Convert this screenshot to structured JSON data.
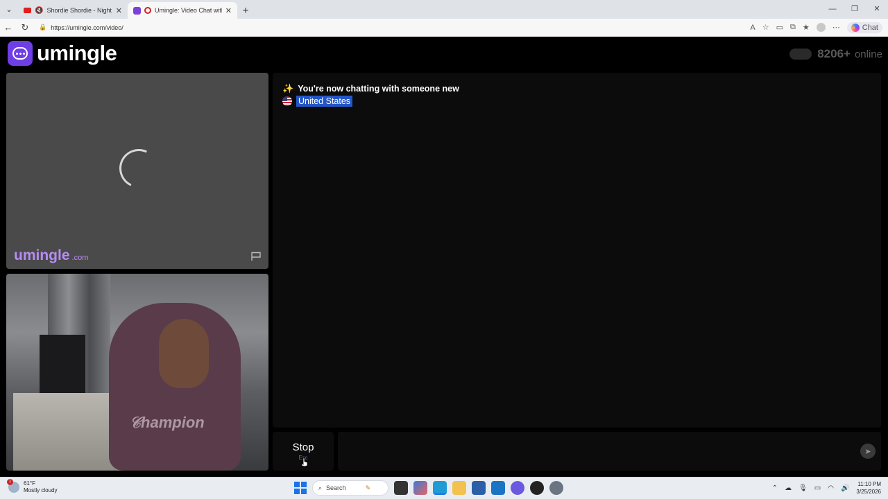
{
  "browser": {
    "tabs": [
      {
        "title": "Shordie Shordie - Night Time",
        "icon": "youtube-icon",
        "muted": true
      },
      {
        "title": "Umingle: Video Chat with Str",
        "icon": "umingle-icon",
        "recording": true
      }
    ],
    "url": "https://umingle.com/video/",
    "chat_label": "Chat"
  },
  "site": {
    "logo_text": "umingle",
    "online_count": "8206+",
    "online_label": "online",
    "watermark_main": "umingle",
    "watermark_tld": ".com",
    "chat": {
      "status_message": "You're now chatting with someone new",
      "country": "United States"
    },
    "stop_label": "Stop",
    "stop_shortcut": "Esc",
    "colors": {
      "brand": "#6f3fe6",
      "highlight": "#2456c8"
    }
  },
  "taskbar": {
    "weather_temp": "61°F",
    "weather_desc": "Mostly cloudy",
    "weather_badge": "1",
    "search_label": "Search",
    "time": "11:10 PM",
    "date": "3/25/2026"
  }
}
